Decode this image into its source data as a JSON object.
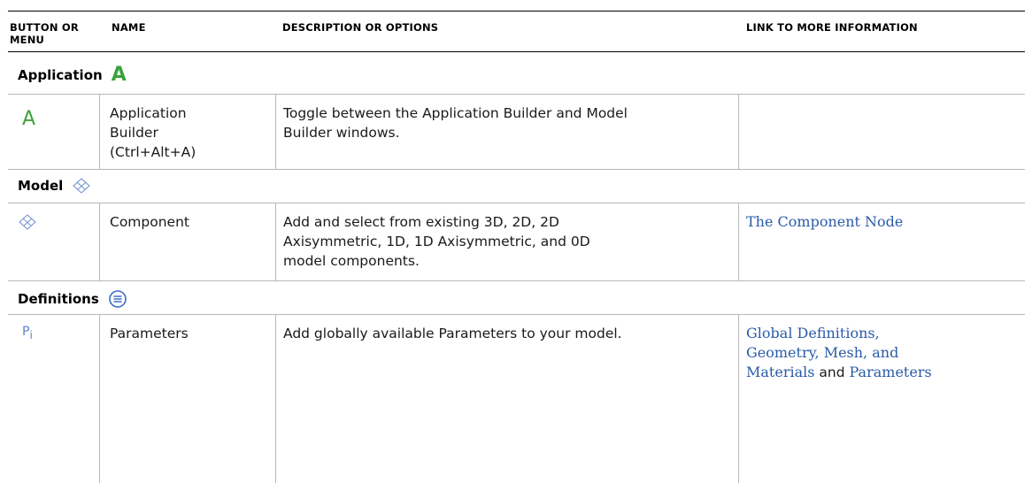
{
  "headers": {
    "button": "BUTTON OR MENU",
    "name": "NAME",
    "description": "DESCRIPTION OR OPTIONS",
    "link": "LINK TO MORE INFORMATION"
  },
  "sections": {
    "application": {
      "title": "Application",
      "icon": "application-builder-icon",
      "icon_glyph": "A",
      "row": {
        "name_line1": "Application",
        "name_line2": "Builder",
        "name_line3": "(Ctrl+Alt+A)",
        "desc_line1": "Toggle between the Application Builder and Model",
        "desc_line2": "Builder windows.",
        "link": ""
      }
    },
    "model": {
      "title": "Model",
      "icon": "component-icon",
      "row": {
        "name": "Component",
        "desc_line1": "Add and select from existing 3D, 2D, 2D",
        "desc_line2": "Axisymmetric, 1D, 1D Axisymmetric, and 0D",
        "desc_line3": "model components.",
        "link": "The Component Node"
      }
    },
    "definitions": {
      "title": "Definitions",
      "icon": "definitions-icon",
      "row": {
        "icon_glyph_main": "P",
        "icon_glyph_sub": "i",
        "name": "Parameters",
        "desc_line1": "Add globally available Parameters to your model.",
        "link_line1": "Global Definitions,",
        "link_line2": "Geometry, Mesh, and",
        "link_line3a": "Materials",
        "link_and": "and",
        "link_line3b": "Parameters"
      }
    }
  },
  "colors": {
    "link": "#2a5ba8",
    "app_icon": "#3aa33a",
    "component_icon": "#6a8ccf",
    "definitions_icon": "#3b6fc4"
  }
}
